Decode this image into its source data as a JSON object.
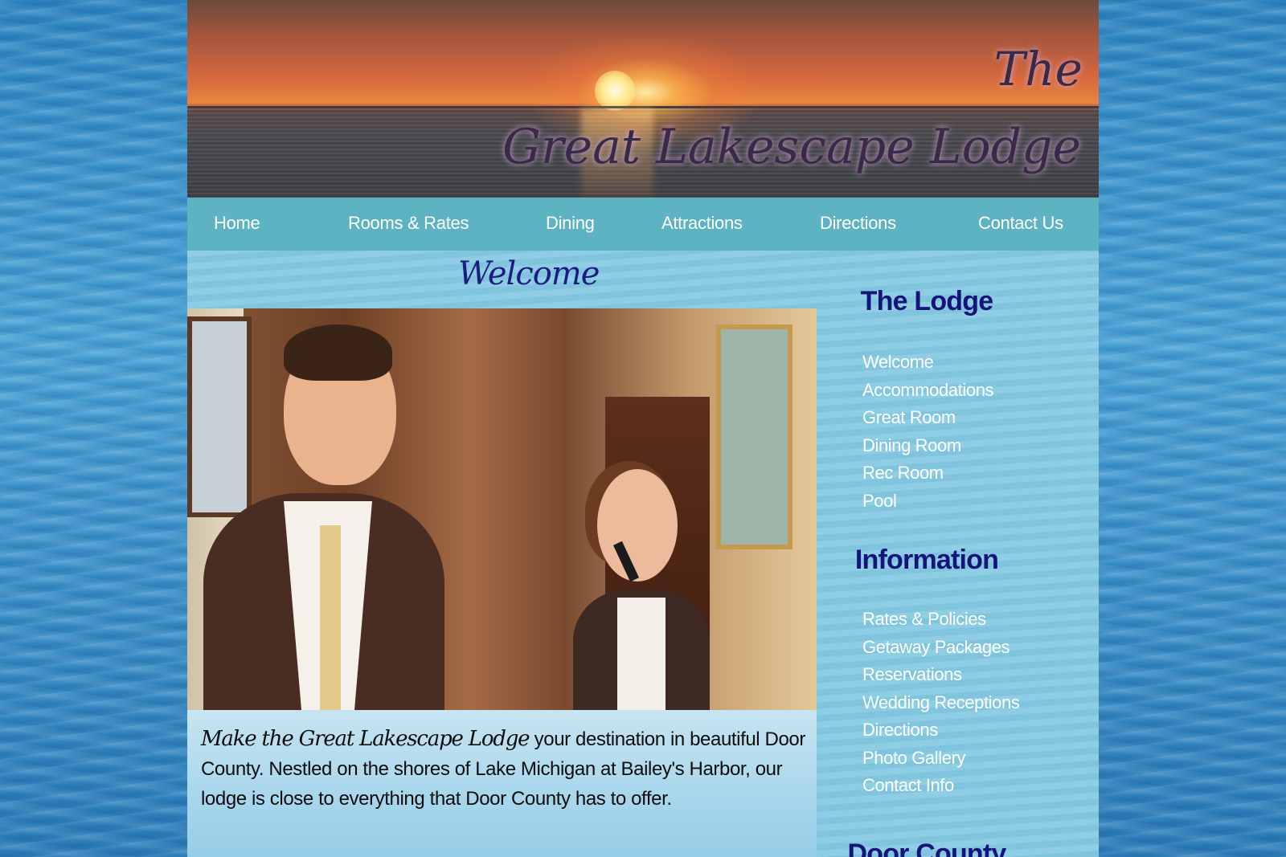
{
  "banner": {
    "title_the": "The",
    "title_main": "Great Lakescape Lodge"
  },
  "nav": {
    "items": [
      "Home",
      "Rooms & Rates",
      "Dining",
      "Attractions",
      "Directions",
      "Contact Us"
    ]
  },
  "main": {
    "heading": "Welcome",
    "intro_script": "Make the Great Lakescape Lodge",
    "intro_text": " your destination in beautiful Door County. Nestled on the shores of Lake Michigan at Bailey's Harbor, our lodge is close to everything that Door County has to offer."
  },
  "sidebar": {
    "lodge_title": "The Lodge",
    "lodge_items": [
      "Welcome",
      "Accommodations",
      "Great Room",
      "Dining Room",
      "Rec Room",
      "Pool"
    ],
    "info_title": "Information",
    "info_items": [
      "Rates & Policies",
      "Getaway Packages",
      "Reservations",
      "Wedding Receptions",
      "Directions",
      "Photo Gallery",
      "Contact Info"
    ],
    "door_title": "Door County"
  },
  "colors": {
    "nav_bg": "#5db3c1",
    "content_bg": "#86c9e2",
    "heading_blue": "#14147a"
  }
}
